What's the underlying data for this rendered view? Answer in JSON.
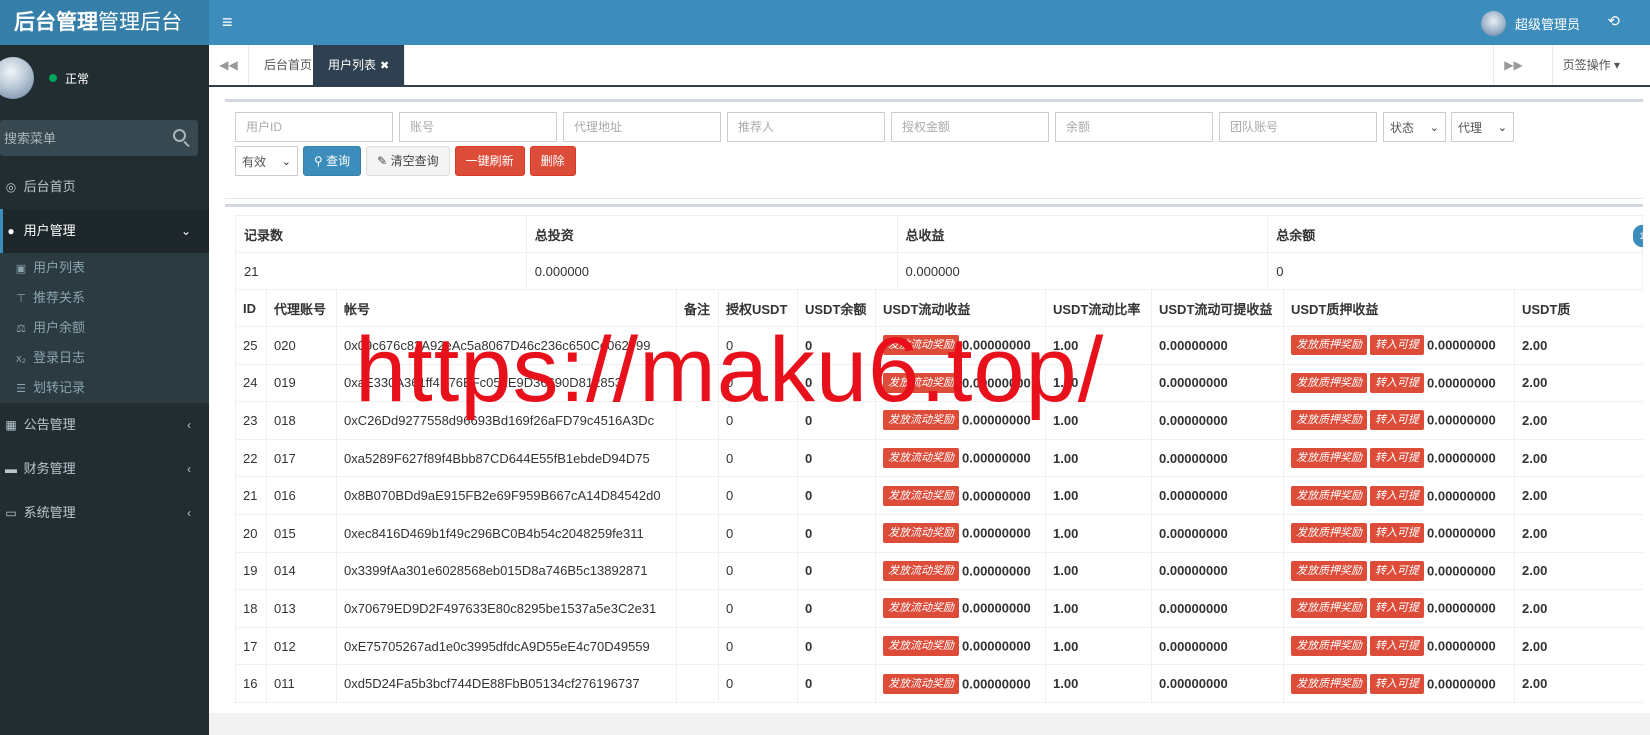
{
  "header": {
    "logo_bold": "后台管理",
    "logo_normal": "管理后台",
    "menu_toggle": "≡",
    "user_name": "超级管理员",
    "refresh_glyph": "⟲"
  },
  "sidebar": {
    "status": "正常",
    "search_placeholder": "搜索菜单",
    "menu": [
      {
        "label": "后台首页",
        "icon": "dashboard-icon"
      },
      {
        "label": "用户管理",
        "icon": "user-icon",
        "expanded": true,
        "children": [
          {
            "label": "用户列表",
            "icon": "id-card-icon"
          },
          {
            "label": "推荐关系",
            "icon": "pin-icon"
          },
          {
            "label": "用户余额",
            "icon": "balance-scale-icon"
          },
          {
            "label": "登录日志",
            "icon": "subscript-icon"
          },
          {
            "label": "划转记录",
            "icon": "list-icon"
          }
        ]
      },
      {
        "label": "公告管理",
        "icon": "image-icon"
      },
      {
        "label": "财务管理",
        "icon": "car-icon"
      },
      {
        "label": "系统管理",
        "icon": "desktop-icon"
      }
    ]
  },
  "tabs": {
    "items": [
      {
        "label": "后台首页",
        "active": false
      },
      {
        "label": "用户列表",
        "active": true
      }
    ],
    "ops_label": "页签操作"
  },
  "filters": {
    "placeholders": [
      "用户ID",
      "账号",
      "代理地址",
      "推荐人",
      "授权金额",
      "余额",
      "团队账号"
    ],
    "status_select": "状态",
    "agent_select": "代理",
    "valid_select": "有效",
    "buttons": {
      "search": "查询",
      "clear": "清空查询",
      "refresh_all": "一键刷新",
      "delete": "删除"
    }
  },
  "summary": {
    "headers": [
      "记录数",
      "总投资",
      "总收益",
      "总余额"
    ],
    "values": [
      "21",
      "0.000000",
      "0.000000",
      "0"
    ]
  },
  "table": {
    "headers": [
      "ID",
      "代理账号",
      "帐号",
      "备注",
      "授权USDT",
      "USDT余额",
      "USDT流动收益",
      "USDT流动比率",
      "USDT流动可提收益",
      "USDT质押收益",
      "USDT质"
    ],
    "btn_flow": "发放流动奖励",
    "btn_pledge": "发放质押奖励",
    "btn_transfer": "转入可提",
    "rows": [
      {
        "id": "25",
        "agent": "020",
        "account": "0x09c676c83A92eAc5a8067D46c236c650Cd062799",
        "note": "",
        "auth": "0",
        "balance": "0",
        "flow": "0.00000000",
        "ratio": "1.00",
        "flow_withdraw": "0.00000000",
        "pledge": "0.00000000",
        "pledge_ratio": "2.00"
      },
      {
        "id": "24",
        "agent": "019",
        "account": "0xaE330A361ff4E76EFc052E9D36690D812853",
        "note": "",
        "auth": "0",
        "balance": "0",
        "flow": "0.00000000",
        "ratio": "1.00",
        "flow_withdraw": "0.00000000",
        "pledge": "0.00000000",
        "pledge_ratio": "2.00"
      },
      {
        "id": "23",
        "agent": "018",
        "account": "0xC26Dd9277558d96693Bd169f26aFD79c4516A3Dc",
        "note": "",
        "auth": "0",
        "balance": "0",
        "flow": "0.00000000",
        "ratio": "1.00",
        "flow_withdraw": "0.00000000",
        "pledge": "0.00000000",
        "pledge_ratio": "2.00"
      },
      {
        "id": "22",
        "agent": "017",
        "account": "0xa5289F627f89f4Bbb87CD644E55fB1ebdeD94D75",
        "note": "",
        "auth": "0",
        "balance": "0",
        "flow": "0.00000000",
        "ratio": "1.00",
        "flow_withdraw": "0.00000000",
        "pledge": "0.00000000",
        "pledge_ratio": "2.00"
      },
      {
        "id": "21",
        "agent": "016",
        "account": "0x8B070BDd9aE915FB2e69F959B667cA14D84542d0",
        "note": "",
        "auth": "0",
        "balance": "0",
        "flow": "0.00000000",
        "ratio": "1.00",
        "flow_withdraw": "0.00000000",
        "pledge": "0.00000000",
        "pledge_ratio": "2.00"
      },
      {
        "id": "20",
        "agent": "015",
        "account": "0xec8416D469b1f49c296BC0B4b54c2048259fe311",
        "note": "",
        "auth": "0",
        "balance": "0",
        "flow": "0.00000000",
        "ratio": "1.00",
        "flow_withdraw": "0.00000000",
        "pledge": "0.00000000",
        "pledge_ratio": "2.00"
      },
      {
        "id": "19",
        "agent": "014",
        "account": "0x3399fAa301e6028568eb015D8a746B5c13892871",
        "note": "",
        "auth": "0",
        "balance": "0",
        "flow": "0.00000000",
        "ratio": "1.00",
        "flow_withdraw": "0.00000000",
        "pledge": "0.00000000",
        "pledge_ratio": "2.00"
      },
      {
        "id": "18",
        "agent": "013",
        "account": "0x70679ED9D2F497633E80c8295be1537a5e3C2e31",
        "note": "",
        "auth": "0",
        "balance": "0",
        "flow": "0.00000000",
        "ratio": "1.00",
        "flow_withdraw": "0.00000000",
        "pledge": "0.00000000",
        "pledge_ratio": "2.00"
      },
      {
        "id": "17",
        "agent": "012",
        "account": "0xE75705267ad1e0c3995dfdcA9D55eE4c70D49559",
        "note": "",
        "auth": "0",
        "balance": "0",
        "flow": "0.00000000",
        "ratio": "1.00",
        "flow_withdraw": "0.00000000",
        "pledge": "0.00000000",
        "pledge_ratio": "2.00"
      },
      {
        "id": "16",
        "agent": "011",
        "account": "0xd5D24Fa5b3bcf744DE88FbB05134cf276196737",
        "note": "",
        "auth": "0",
        "balance": "0",
        "flow": "0.00000000",
        "ratio": "1.00",
        "flow_withdraw": "0.00000000",
        "pledge": "0.00000000",
        "pledge_ratio": "2.00"
      }
    ]
  },
  "watermark": "https://maku6.top/",
  "colors": {
    "header": "#3c8dbc",
    "sidebar": "#222d32",
    "danger": "#dd4b39",
    "watermark": "#e8101b"
  }
}
